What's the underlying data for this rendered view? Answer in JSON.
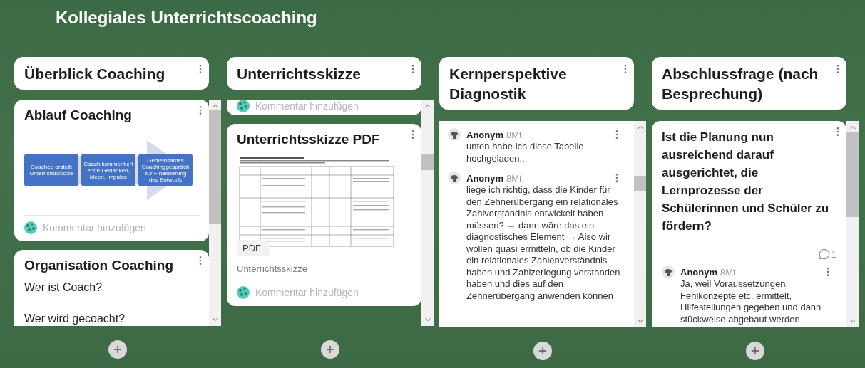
{
  "board_title": "Kollegiales Unterrichtscoaching",
  "columns": [
    {
      "title": "Überblick Coaching",
      "cards": [
        {
          "kind": "diagram",
          "title": "Ablauf Coaching",
          "steps": [
            "Coachee erstellt Unterrichtsskizze",
            "Coach kommentiert erste Gedanken, Ideen, Impulse",
            "Gemeinsames Coachinggespräch zur Finalisierung des Entwurfs"
          ],
          "comment_placeholder": "Kommentar hinzufügen"
        },
        {
          "kind": "text",
          "title": "Organisation Coaching",
          "lines": [
            "Wer ist Coach?",
            "Wer wird gecoacht?"
          ]
        }
      ]
    },
    {
      "title": "Unterrichtsskizze",
      "cards": [
        {
          "kind": "footer",
          "comment_placeholder": "Kommentar hinzufügen"
        },
        {
          "kind": "pdf",
          "title": "Unterrichtsskizze PDF",
          "badge": "PDF",
          "caption": "Unterrichtsskizze",
          "comment_placeholder": "Kommentar hinzufügen"
        }
      ]
    },
    {
      "title": "Kernperspektive Diagnostik",
      "cards": [
        {
          "kind": "comments",
          "comments": [
            {
              "author": "Anonym",
              "time": "8Mt.",
              "text": "unten habe ich diese Tabelle hochgeladen..."
            },
            {
              "author": "Anonym",
              "time": "8Mt.",
              "text": "liege ich richtig, dass die Kinder für den Zehnerübergang ein relationales Zahlverständnis entwickelt haben müssen? → dann wäre das ein diagnostisches Element → Also wir wollen quasi ermitteln, ob die Kinder ein relationales Zahlenverständnis haben und Zahlzerlegung verstanden haben und dies auf den Zehnerübergang anwenden können"
            }
          ]
        }
      ]
    },
    {
      "title": "Abschlussfrage (nach Besprechung)",
      "cards": [
        {
          "kind": "question",
          "title": "Ist die Planung nun ausreichend darauf ausgerichtet, die Lernprozesse der Schülerinnen und Schüler zu fördern?",
          "comment_count": "1",
          "comments": [
            {
              "author": "Anonym",
              "time": "8Mt.",
              "text": "Ja, weil Voraussetzungen, Fehlkonzepte etc. ermittelt, Hilfestellungen gegeben und dann stückweise abgebaut werden"
            }
          ]
        }
      ]
    }
  ]
}
